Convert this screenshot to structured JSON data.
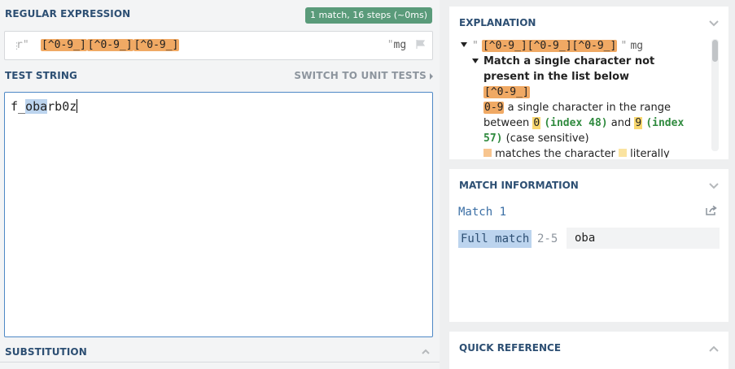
{
  "regex": {
    "section_title": "REGULAR EXPRESSION",
    "match_badge": "1 match, 16 steps (~0ms)",
    "prefix": "r\"",
    "pattern_parts": [
      "[^0-9_]",
      "[^0-9_]",
      "[^0-9_]"
    ],
    "closing_quote": "\"",
    "flags": "mg"
  },
  "test": {
    "section_title": "TEST STRING",
    "switch_label": "SWITCH TO UNIT TESTS",
    "text_before": "f_",
    "text_match": "oba",
    "text_after": "rb0z"
  },
  "substitution": {
    "section_title": "SUBSTITUTION"
  },
  "explanation": {
    "title": "EXPLANATION",
    "root_quote_open": "\"",
    "root_pattern": "[^0-9_][^0-9_][^0-9_]",
    "root_quote_close": "\"",
    "root_flags": "mg",
    "item_title": "Match a single character not present in the list below",
    "item_token": "[^0-9_]",
    "range_token": "0-9",
    "range_text_1": "a single character in the range between",
    "range_from": "0",
    "range_from_index": "(index 48)",
    "range_and": "and",
    "range_to": "9",
    "range_to_index": "(index 57)",
    "range_case": "(case sensitive)",
    "literal_text_1": "matches the character",
    "literal_text_2": "literally (case"
  },
  "match_info": {
    "title": "MATCH INFORMATION",
    "match_label": "Match 1",
    "full_match_label": "Full match",
    "range": "2-5",
    "value": "oba"
  },
  "quick_reference": {
    "title": "QUICK REFERENCE"
  }
}
